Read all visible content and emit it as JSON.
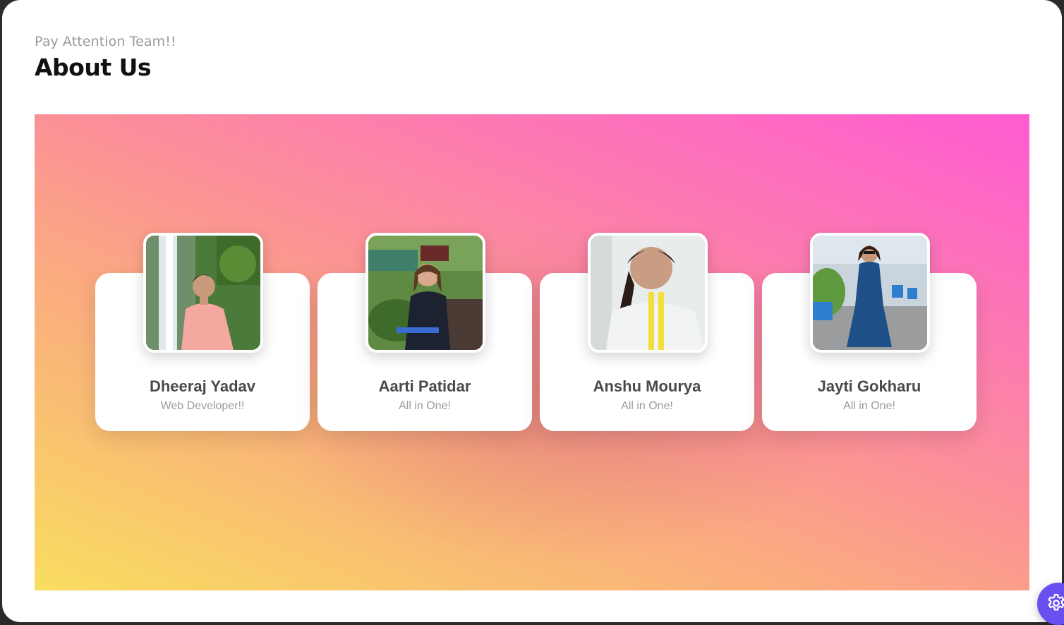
{
  "header": {
    "subtitle": "Pay Attention Team!!",
    "title": "About Us"
  },
  "banner": {
    "gradient_colors": [
      "#f9dd60",
      "#fbac7f",
      "#fb9493",
      "#ff5bd2"
    ]
  },
  "team": [
    {
      "name": "Dheeraj Yadav",
      "role": "Web Developer!!",
      "photo": "portrait-waterfall-photo"
    },
    {
      "name": "Aarti Patidar",
      "role": "All in One!",
      "photo": "portrait-garden-photo"
    },
    {
      "name": "Anshu Mourya",
      "role": "All in One!",
      "photo": "portrait-selfie-photo"
    },
    {
      "name": "Jayti Gokharu",
      "role": "All in One!",
      "photo": "portrait-plants-photo"
    }
  ],
  "settings_button": {
    "icon": "gear-icon",
    "color": "#6b4ef0"
  }
}
